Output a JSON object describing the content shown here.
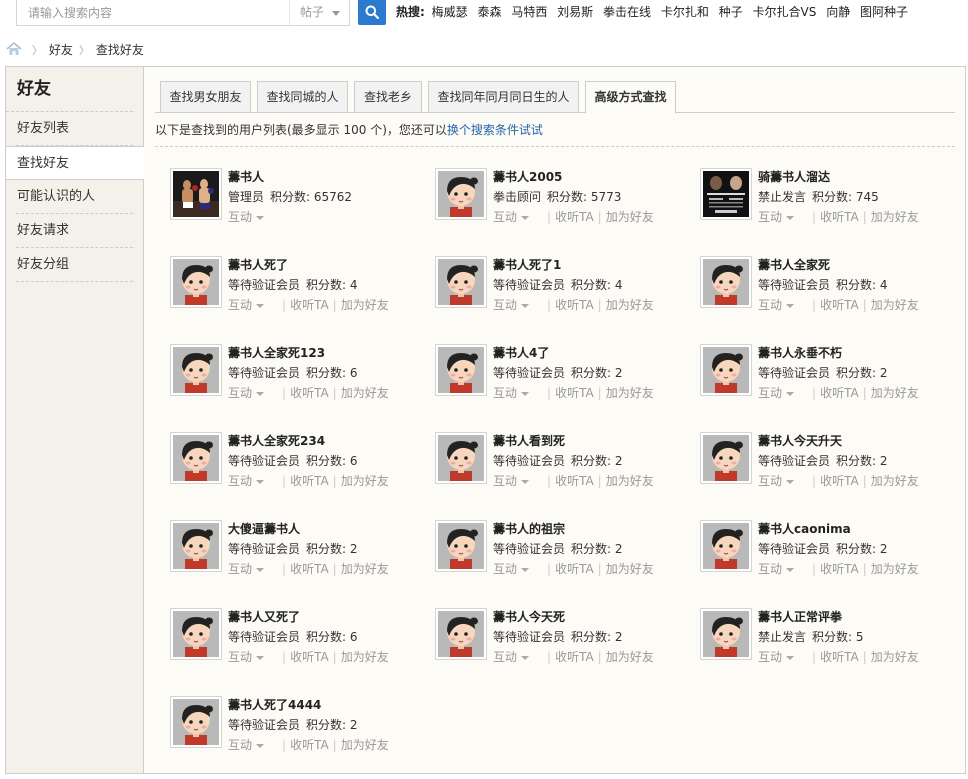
{
  "search": {
    "placeholder": "请输入搜索内容",
    "type_label": "帖子"
  },
  "hot": {
    "label": "热搜:",
    "items": [
      "梅威瑟",
      "泰森",
      "马特西",
      "刘易斯",
      "拳击在线",
      "卡尔扎和",
      "种子",
      "卡尔扎合VS",
      "向静",
      "图阿种子"
    ]
  },
  "breadcrumb": [
    "好友",
    "查找好友"
  ],
  "sidebar": {
    "title": "好友",
    "items": [
      {
        "label": "好友列表"
      },
      {
        "label": "查找好友"
      },
      {
        "label": "可能认识的人"
      },
      {
        "label": "好友请求"
      },
      {
        "label": "好友分组"
      }
    ]
  },
  "tabs": [
    "查找男女朋友",
    "查找同城的人",
    "查找老乡",
    "查找同年同月同日生的人",
    "高级方式查找"
  ],
  "info": {
    "text": "以下是查找到的用户列表(最多显示 100 个)，您还可以",
    "link": "换个搜索条件试试"
  },
  "actions": {
    "interact": "互动",
    "follow": "收听TA",
    "add": "加为好友"
  },
  "users": [
    {
      "name": "薵书人",
      "role": "管理员",
      "score": "积分数: 65762",
      "avatar": "boxing-photo-icon",
      "can_follow": false
    },
    {
      "name": "薵书人2005",
      "role": "拳击顾问",
      "score": "积分数: 5773",
      "avatar": "default-avatar-icon",
      "can_follow": true
    },
    {
      "name": "骑薵书人溜达",
      "role": "禁止发言",
      "score": "积分数: 745",
      "avatar": "poster-photo-icon",
      "can_follow": true
    },
    {
      "name": "薵书人死了",
      "role": "等待验证会员",
      "score": "积分数: 4",
      "avatar": "default-avatar-icon",
      "can_follow": true
    },
    {
      "name": "薵书人死了1",
      "role": "等待验证会员",
      "score": "积分数: 4",
      "avatar": "default-avatar-icon",
      "can_follow": true
    },
    {
      "name": "薵书人全家死",
      "role": "等待验证会员",
      "score": "积分数: 4",
      "avatar": "default-avatar-icon",
      "can_follow": true
    },
    {
      "name": "薵书人全家死123",
      "role": "等待验证会员",
      "score": "积分数: 6",
      "avatar": "default-avatar-icon",
      "can_follow": true
    },
    {
      "name": "薵书人4了",
      "role": "等待验证会员",
      "score": "积分数: 2",
      "avatar": "default-avatar-icon",
      "can_follow": true
    },
    {
      "name": "薵书人永垂不朽",
      "role": "等待验证会员",
      "score": "积分数: 2",
      "avatar": "default-avatar-icon",
      "can_follow": true
    },
    {
      "name": "薵书人全家死234",
      "role": "等待验证会员",
      "score": "积分数: 6",
      "avatar": "default-avatar-icon",
      "can_follow": true
    },
    {
      "name": "薵书人看到死",
      "role": "等待验证会员",
      "score": "积分数: 2",
      "avatar": "default-avatar-icon",
      "can_follow": true
    },
    {
      "name": "薵书人今天升天",
      "role": "等待验证会员",
      "score": "积分数: 2",
      "avatar": "default-avatar-icon",
      "can_follow": true
    },
    {
      "name": "大傻逼薵书人",
      "role": "等待验证会员",
      "score": "积分数: 2",
      "avatar": "default-avatar-icon",
      "can_follow": true
    },
    {
      "name": "薵书人的祖宗",
      "role": "等待验证会员",
      "score": "积分数: 2",
      "avatar": "default-avatar-icon",
      "can_follow": true
    },
    {
      "name": "薵书人caonima",
      "role": "等待验证会员",
      "score": "积分数: 2",
      "avatar": "default-avatar-icon",
      "can_follow": true
    },
    {
      "name": "薵书人又死了",
      "role": "等待验证会员",
      "score": "积分数: 6",
      "avatar": "default-avatar-icon",
      "can_follow": true
    },
    {
      "name": "薵书人今天死",
      "role": "等待验证会员",
      "score": "积分数: 2",
      "avatar": "default-avatar-icon",
      "can_follow": true
    },
    {
      "name": "薵书人正常评拳",
      "role": "禁止发言",
      "score": "积分数: 5",
      "avatar": "default-avatar-icon",
      "can_follow": true
    },
    {
      "name": "薵书人死了4444",
      "role": "等待验证会员",
      "score": "积分数: 2",
      "avatar": "default-avatar-icon",
      "can_follow": true
    }
  ],
  "colors": {
    "accent": "#2b7acd",
    "link": "#2366a8",
    "panel_bg": "#fdfbf6",
    "sidebar_bg": "#f4f1ea"
  }
}
